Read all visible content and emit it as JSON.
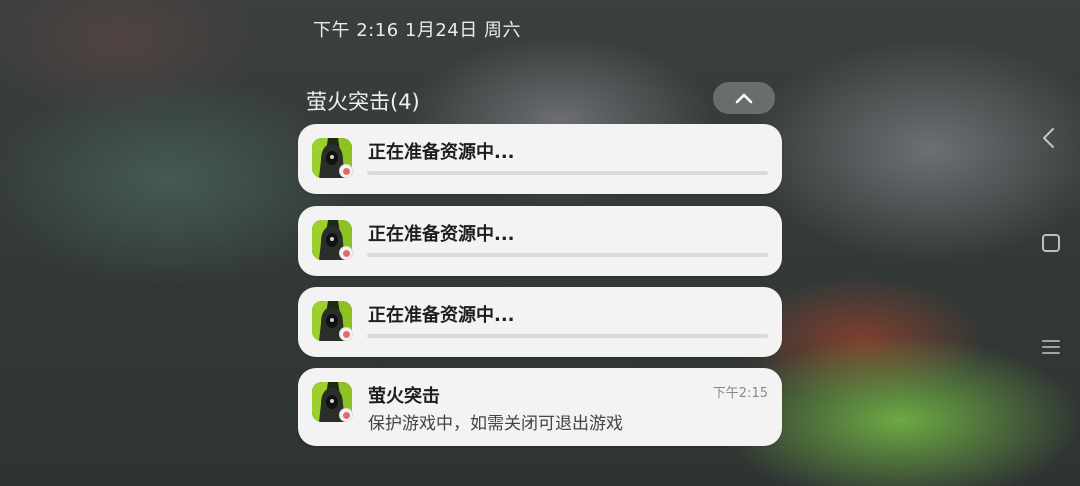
{
  "status": {
    "time_date": "下午 2:16   1月24日 周六"
  },
  "group": {
    "title": "萤火突击(4)"
  },
  "notifications": [
    {
      "title": "正在准备资源中...",
      "progress": 0
    },
    {
      "title": "正在准备资源中...",
      "progress": 0
    },
    {
      "title": "正在准备资源中...",
      "progress": 0
    }
  ],
  "message": {
    "app_name": "萤火突击",
    "time": "下午2:15",
    "body": "保护游戏中，如需关闭可退出游戏"
  },
  "icons": {
    "collapse": "chevron-up-icon",
    "app": "app-icon",
    "back": "nav-back-icon",
    "home": "nav-home-icon",
    "recent": "nav-recent-icon"
  },
  "colors": {
    "card_bg": "#f2f3f2",
    "app_icon_green": "#9bd12a"
  }
}
